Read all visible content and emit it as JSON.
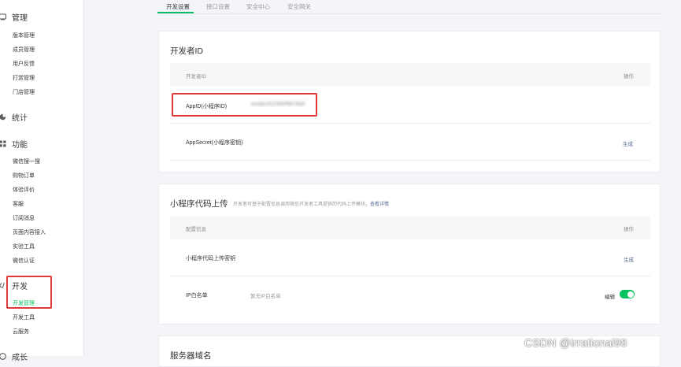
{
  "sidebar": {
    "groups": [
      {
        "label": "管理",
        "icon": "manage-icon",
        "items": [
          "版本管理",
          "成员管理",
          "用户反馈",
          "打赏管理",
          "门店管理"
        ]
      },
      {
        "label": "统计",
        "icon": "chart-pie-icon",
        "items": []
      },
      {
        "label": "功能",
        "icon": "grid-icon",
        "items": [
          "微信搜一搜",
          "购物订单",
          "体验评价",
          "客服",
          "订阅消息",
          "页面内容接入",
          "实验工具",
          "微信认证"
        ]
      },
      {
        "label": "开发",
        "icon": "code-icon",
        "items": [
          "开发管理",
          "开发工具",
          "云服务"
        ]
      },
      {
        "label": "成长",
        "icon": "growth-icon",
        "items": []
      }
    ]
  },
  "tabs": [
    "开发设置",
    "接口设置",
    "安全中心",
    "安全网关"
  ],
  "active_tab": "开发设置",
  "developer_id_card": {
    "title": "开发者ID",
    "header_col1": "开发者ID",
    "header_col2": "操作",
    "appid_label": "AppID(小程序ID)",
    "appid_value": "wxabcd1234ef5678a5",
    "appsecret_label": "AppSecret(小程序密钥)",
    "appsecret_action": "生成"
  },
  "code_upload_card": {
    "title": "小程序代码上传",
    "description": "开发者可基于配置信息调用微信开发者工具提供的代码上传模块。",
    "description_link": "查看详情",
    "header_col1": "配置信息",
    "header_col2": "操作",
    "key_label": "小程序代码上传密钥",
    "key_action": "生成",
    "ip_label": "IP白名单",
    "ip_value": "暂无IP白名单",
    "ip_action": "编辑",
    "ip_toggle_on": true
  },
  "domain_card": {
    "title": "服务器域名"
  },
  "watermark": "CSDN @irrational98",
  "colors": {
    "accent": "#07c160",
    "link": "#576b95",
    "highlight": "#e03a3a"
  }
}
